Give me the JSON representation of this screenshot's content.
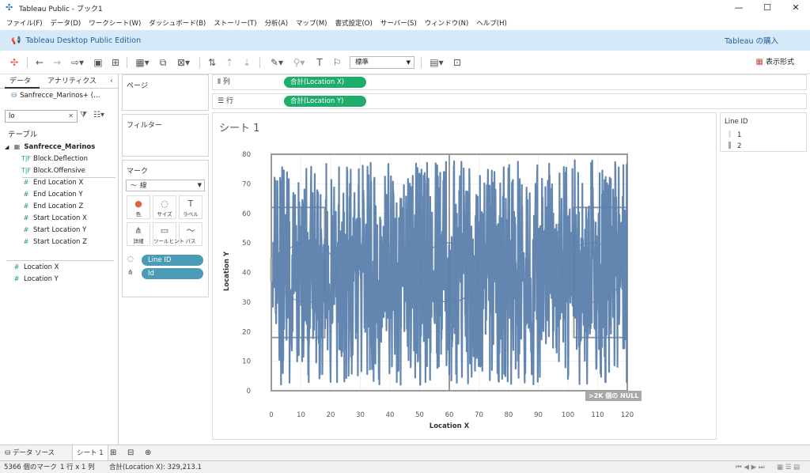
{
  "window": {
    "title": "Tableau Public - ブック1",
    "minimize": "—",
    "maximize": "☐",
    "close": "✕"
  },
  "menu": [
    "ファイル(F)",
    "データ(D)",
    "ワークシート(W)",
    "ダッシュボード(B)",
    "ストーリー(T)",
    "分析(A)",
    "マップ(M)",
    "書式設定(O)",
    "サーバー(S)",
    "ウィンドウ(N)",
    "ヘルプ(H)"
  ],
  "banner": {
    "edition": "Tableau Desktop Public Edition",
    "buy": "Tableau の購入"
  },
  "toolbar": {
    "fit": "標準",
    "show_me": "表示形式"
  },
  "data_pane": {
    "tab_data": "データ",
    "tab_analytics": "アナリティクス",
    "source": "Sanfrecce_Marinos+ (…",
    "search_value": "lo",
    "tables_label": "テーブル",
    "table_name": "Sanfrecce_Marinos",
    "fields": [
      {
        "type": "T|F",
        "name": "Block.Deflection"
      },
      {
        "type": "T|F",
        "name": "Block.Offensive"
      },
      {
        "type": "#",
        "name": "End Location X"
      },
      {
        "type": "#",
        "name": "End Location Y"
      },
      {
        "type": "#",
        "name": "End Location Z"
      },
      {
        "type": "#",
        "name": "Start Location X"
      },
      {
        "type": "#",
        "name": "Start Location Y"
      },
      {
        "type": "#",
        "name": "Start Location Z"
      }
    ],
    "calc_fields": [
      "Location X",
      "Location Y"
    ]
  },
  "shelves": {
    "pages": "ページ",
    "filters": "フィルター",
    "marks": "マーク",
    "mark_type": "線",
    "mark_buttons": [
      {
        "icon": "●",
        "label": "色"
      },
      {
        "icon": "◌",
        "label": "サイズ"
      },
      {
        "icon": "T",
        "label": "ラベル"
      },
      {
        "icon": "⋔",
        "label": "詳細"
      },
      {
        "icon": "▭",
        "label": "ツールヒント"
      },
      {
        "icon": "〜",
        "label": "パス"
      }
    ],
    "mark_pills": [
      "Line ID",
      "Id"
    ],
    "columns_label": "列",
    "rows_label": "行",
    "columns_pill": "合計(Location X)",
    "rows_pill": "合計(Location Y)"
  },
  "view": {
    "sheet_title": "シート 1",
    "null_badge": ">2K 個の NULL"
  },
  "chart_data": {
    "type": "line",
    "xlabel": "Location X",
    "ylabel": "Location Y",
    "xlim": [
      0,
      120
    ],
    "ylim": [
      0,
      80
    ],
    "xticks": [
      0,
      10,
      20,
      30,
      40,
      50,
      60,
      70,
      80,
      90,
      100,
      110,
      120
    ],
    "yticks": [
      0,
      10,
      20,
      30,
      40,
      50,
      60,
      70,
      80
    ],
    "series": [
      {
        "name": "1",
        "color": "#5b7fad"
      },
      {
        "name": "2",
        "color": "#a8a8a8"
      }
    ]
  },
  "legend": {
    "title": "Line ID",
    "items": [
      {
        "label": "1",
        "color": "#e0e0e0"
      },
      {
        "label": "2",
        "color": "#a8a8a8"
      }
    ]
  },
  "sheet_tabs": {
    "data_source": "データ ソース",
    "sheet": "シート 1"
  },
  "status": {
    "marks": "5366 個のマーク",
    "grid": "1 行 x 1 列",
    "sum": "合計(Location X): 329,213.1"
  }
}
